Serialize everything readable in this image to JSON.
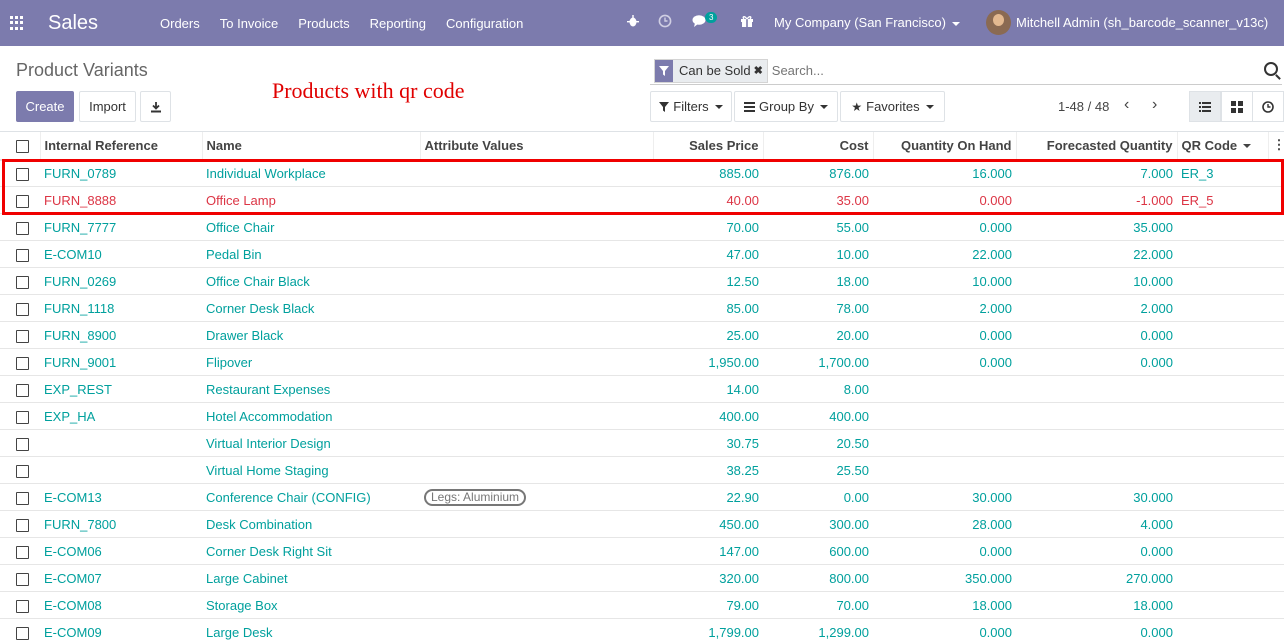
{
  "navbar": {
    "app_name": "Sales",
    "menu": [
      "Orders",
      "To Invoice",
      "Products",
      "Reporting",
      "Configuration"
    ],
    "messages_count": "3",
    "company": "My Company (San Francisco)",
    "user": "Mitchell Admin (sh_barcode_scanner_v13c)"
  },
  "page": {
    "title": "Product Variants",
    "create_label": "Create",
    "import_label": "Import",
    "annotation": "Products with qr code"
  },
  "search": {
    "facet": "Can be Sold",
    "placeholder": "Search..."
  },
  "filters": {
    "filters_label": "Filters",
    "groupby_label": "Group By",
    "favorites_label": "Favorites"
  },
  "pager": {
    "text": "1-48 / 48"
  },
  "table": {
    "headers": [
      "Internal Reference",
      "Name",
      "Attribute Values",
      "Sales Price",
      "Cost",
      "Quantity On Hand",
      "Forecasted Quantity",
      "QR Code"
    ],
    "rows": [
      {
        "ref": "FURN_0789",
        "name": "Individual Workplace",
        "attr": "",
        "price": "885.00",
        "cost": "876.00",
        "qty": "16.000",
        "forecast": "7.000",
        "qr": "ER_3"
      },
      {
        "ref": "FURN_8888",
        "name": "Office Lamp",
        "attr": "",
        "price": "40.00",
        "cost": "35.00",
        "qty": "0.000",
        "forecast": "-1.000",
        "qr": "ER_5"
      },
      {
        "ref": "FURN_7777",
        "name": "Office Chair",
        "attr": "",
        "price": "70.00",
        "cost": "55.00",
        "qty": "0.000",
        "forecast": "35.000",
        "qr": ""
      },
      {
        "ref": "E-COM10",
        "name": "Pedal Bin",
        "attr": "",
        "price": "47.00",
        "cost": "10.00",
        "qty": "22.000",
        "forecast": "22.000",
        "qr": ""
      },
      {
        "ref": "FURN_0269",
        "name": "Office Chair Black",
        "attr": "",
        "price": "12.50",
        "cost": "18.00",
        "qty": "10.000",
        "forecast": "10.000",
        "qr": ""
      },
      {
        "ref": "FURN_1118",
        "name": "Corner Desk Black",
        "attr": "",
        "price": "85.00",
        "cost": "78.00",
        "qty": "2.000",
        "forecast": "2.000",
        "qr": ""
      },
      {
        "ref": "FURN_8900",
        "name": "Drawer Black",
        "attr": "",
        "price": "25.00",
        "cost": "20.00",
        "qty": "0.000",
        "forecast": "0.000",
        "qr": ""
      },
      {
        "ref": "FURN_9001",
        "name": "Flipover",
        "attr": "",
        "price": "1,950.00",
        "cost": "1,700.00",
        "qty": "0.000",
        "forecast": "0.000",
        "qr": ""
      },
      {
        "ref": "EXP_REST",
        "name": "Restaurant Expenses",
        "attr": "",
        "price": "14.00",
        "cost": "8.00",
        "qty": "",
        "forecast": "",
        "qr": ""
      },
      {
        "ref": "EXP_HA",
        "name": "Hotel Accommodation",
        "attr": "",
        "price": "400.00",
        "cost": "400.00",
        "qty": "",
        "forecast": "",
        "qr": ""
      },
      {
        "ref": "",
        "name": "Virtual Interior Design",
        "attr": "",
        "price": "30.75",
        "cost": "20.50",
        "qty": "",
        "forecast": "",
        "qr": ""
      },
      {
        "ref": "",
        "name": "Virtual Home Staging",
        "attr": "",
        "price": "38.25",
        "cost": "25.50",
        "qty": "",
        "forecast": "",
        "qr": ""
      },
      {
        "ref": "E-COM13",
        "name": "Conference Chair (CONFIG)",
        "attr": "Legs: Aluminium",
        "price": "22.90",
        "cost": "0.00",
        "qty": "30.000",
        "forecast": "30.000",
        "qr": ""
      },
      {
        "ref": "FURN_7800",
        "name": "Desk Combination",
        "attr": "",
        "price": "450.00",
        "cost": "300.00",
        "qty": "28.000",
        "forecast": "4.000",
        "qr": ""
      },
      {
        "ref": "E-COM06",
        "name": "Corner Desk Right Sit",
        "attr": "",
        "price": "147.00",
        "cost": "600.00",
        "qty": "0.000",
        "forecast": "0.000",
        "qr": ""
      },
      {
        "ref": "E-COM07",
        "name": "Large Cabinet",
        "attr": "",
        "price": "320.00",
        "cost": "800.00",
        "qty": "350.000",
        "forecast": "270.000",
        "qr": ""
      },
      {
        "ref": "E-COM08",
        "name": "Storage Box",
        "attr": "",
        "price": "79.00",
        "cost": "70.00",
        "qty": "18.000",
        "forecast": "18.000",
        "qr": ""
      },
      {
        "ref": "E-COM09",
        "name": "Large Desk",
        "attr": "",
        "price": "1,799.00",
        "cost": "1,299.00",
        "qty": "0.000",
        "forecast": "0.000",
        "qr": ""
      }
    ]
  },
  "colors": {
    "brand": "#7c7bad",
    "link": "#00a09d",
    "danger": "#dc3545",
    "highlight": "#f00000"
  }
}
